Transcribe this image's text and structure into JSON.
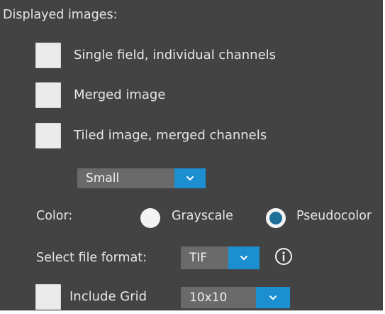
{
  "section": {
    "title": "Displayed images:"
  },
  "options": {
    "single_field": {
      "label": "Single field, individual channels",
      "checked": false
    },
    "merged": {
      "label": "Merged image",
      "checked": false
    },
    "tiled": {
      "label": "Tiled image, merged channels",
      "checked": false
    }
  },
  "size_dropdown": {
    "value": "Small"
  },
  "color": {
    "label": "Color:",
    "grayscale_label": "Grayscale",
    "pseudocolor_label": "Pseudocolor",
    "selected": "Pseudocolor"
  },
  "file_format": {
    "label": "Select file format:",
    "value": "TIF"
  },
  "grid": {
    "label": "Include Grid",
    "checked": false,
    "value": "10x10"
  },
  "colors": {
    "background": "#434343",
    "accent": "#1b8fcf",
    "dropdown_fill": "#6a6a6a",
    "radio_selected": "#1d6f98"
  },
  "icons": [
    "chevron-down-icon",
    "info-icon"
  ]
}
